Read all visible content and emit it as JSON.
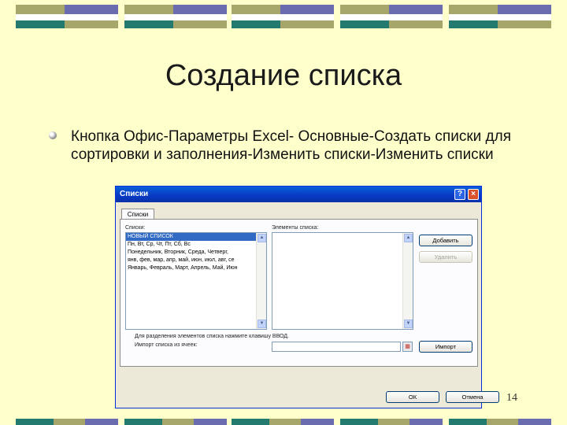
{
  "slide": {
    "title": "Создание списка",
    "bullet": "Кнопка Офис-Параметры Excel- Основные-Создать списки для сортировки и заполнения-Изменить списки-Изменить списки",
    "page_number": "14"
  },
  "colors": {
    "stripe_blue": "#6b6bb0",
    "stripe_olive": "#a6a66a",
    "stripe_teal": "#247a6e",
    "background": "#ffffcc"
  },
  "dialog": {
    "title": "Списки",
    "help_glyph": "?",
    "close_glyph": "×",
    "tab_label": "Списки",
    "lists_label": "Списки:",
    "lists": [
      "НОВЫЙ СПИСОК",
      "Пн, Вт, Ср, Чт, Пт, Сб, Вс",
      "Понедельник, Вторник, Среда, Четверг,",
      "янв, фев, мар, апр, май, июн, июл, авг, се",
      "Январь, Февраль, Март, Апрель, Май, Июн"
    ],
    "elements_label": "Элементы списка:",
    "add_button": "Добавить",
    "delete_button": "Удалить",
    "hint": "Для разделения элементов списка нажмите клавишу ВВОД.",
    "import_label": "Импорт списка из ячеек:",
    "import_button": "Импорт",
    "ok_button": "ОК",
    "cancel_button": "Отмена"
  }
}
